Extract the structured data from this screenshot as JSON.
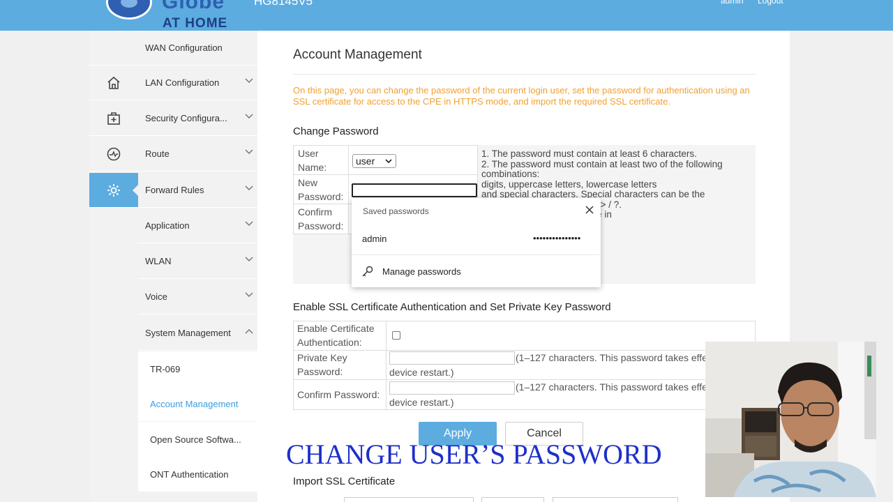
{
  "header": {
    "brand_word": "Globe",
    "brand_sub": "AT HOME",
    "model": "HG8145V5",
    "user_link": "admin",
    "logout_link": "Logout"
  },
  "sidebar_icons": [
    "home-icon",
    "first-aid-kit-icon",
    "gauge-icon",
    "gear-icon"
  ],
  "menu": {
    "items": [
      {
        "label": "WAN Configuration"
      },
      {
        "label": "LAN Configuration"
      },
      {
        "label": "Security Configura..."
      },
      {
        "label": "Route"
      },
      {
        "label": "Forward Rules"
      },
      {
        "label": "Application"
      },
      {
        "label": "WLAN"
      },
      {
        "label": "Voice"
      },
      {
        "label": "System Management"
      }
    ],
    "sub_items": [
      {
        "label": "TR-069"
      },
      {
        "label": "Account Management"
      },
      {
        "label": "Open Source Softwa..."
      },
      {
        "label": "ONT Authentication"
      }
    ]
  },
  "page": {
    "title": "Account Management",
    "intro": "On this page, you can change the password of the current login user, set the password for authentication using an SSL certificate for access to the CPE in HTTPS mode, and import the required SSL certificate.",
    "change_password": {
      "heading": "Change Password",
      "user_name_label": "User Name:",
      "user_name_value": "user",
      "new_password_label": "New Password:",
      "confirm_password_label": "Confirm Password:",
      "hints": "1. The password must contain at least 6 characters.\n2. The password must contain at least two of the following combinations:\n    digits, uppercase letters, lowercase letters\n    and special characters. Special characters can be the\n                                     \" ( ) - _ = + \\ | [ { } ] ; : ' \" < , . > / ?.\n                                     any user name or user name in"
    },
    "saved_passwords_popup": {
      "title": "Saved passwords",
      "username": "admin",
      "masked_password": "•••••••••••••••",
      "manage_label": "Manage passwords"
    },
    "ssl": {
      "heading": "Enable SSL Certificate Authentication and Set Private Key Password",
      "enable_label": "Enable Certificate Authentication:",
      "private_key_label": "Private Key Password:",
      "confirm_label": "Confirm Password:",
      "note_line1": "(1–127 characters. This password takes effe",
      "note_line2": "device restart.)"
    },
    "apply_label": "Apply",
    "cancel_label": "Cancel",
    "import_heading": "Import SSL Certificate"
  },
  "caption": "CHANGE USER’S PASSWORD",
  "colors": {
    "accent": "#5cace0",
    "intro_text": "#f0a030",
    "caption": "#1e2fc9",
    "active_link": "#3a9de0"
  }
}
